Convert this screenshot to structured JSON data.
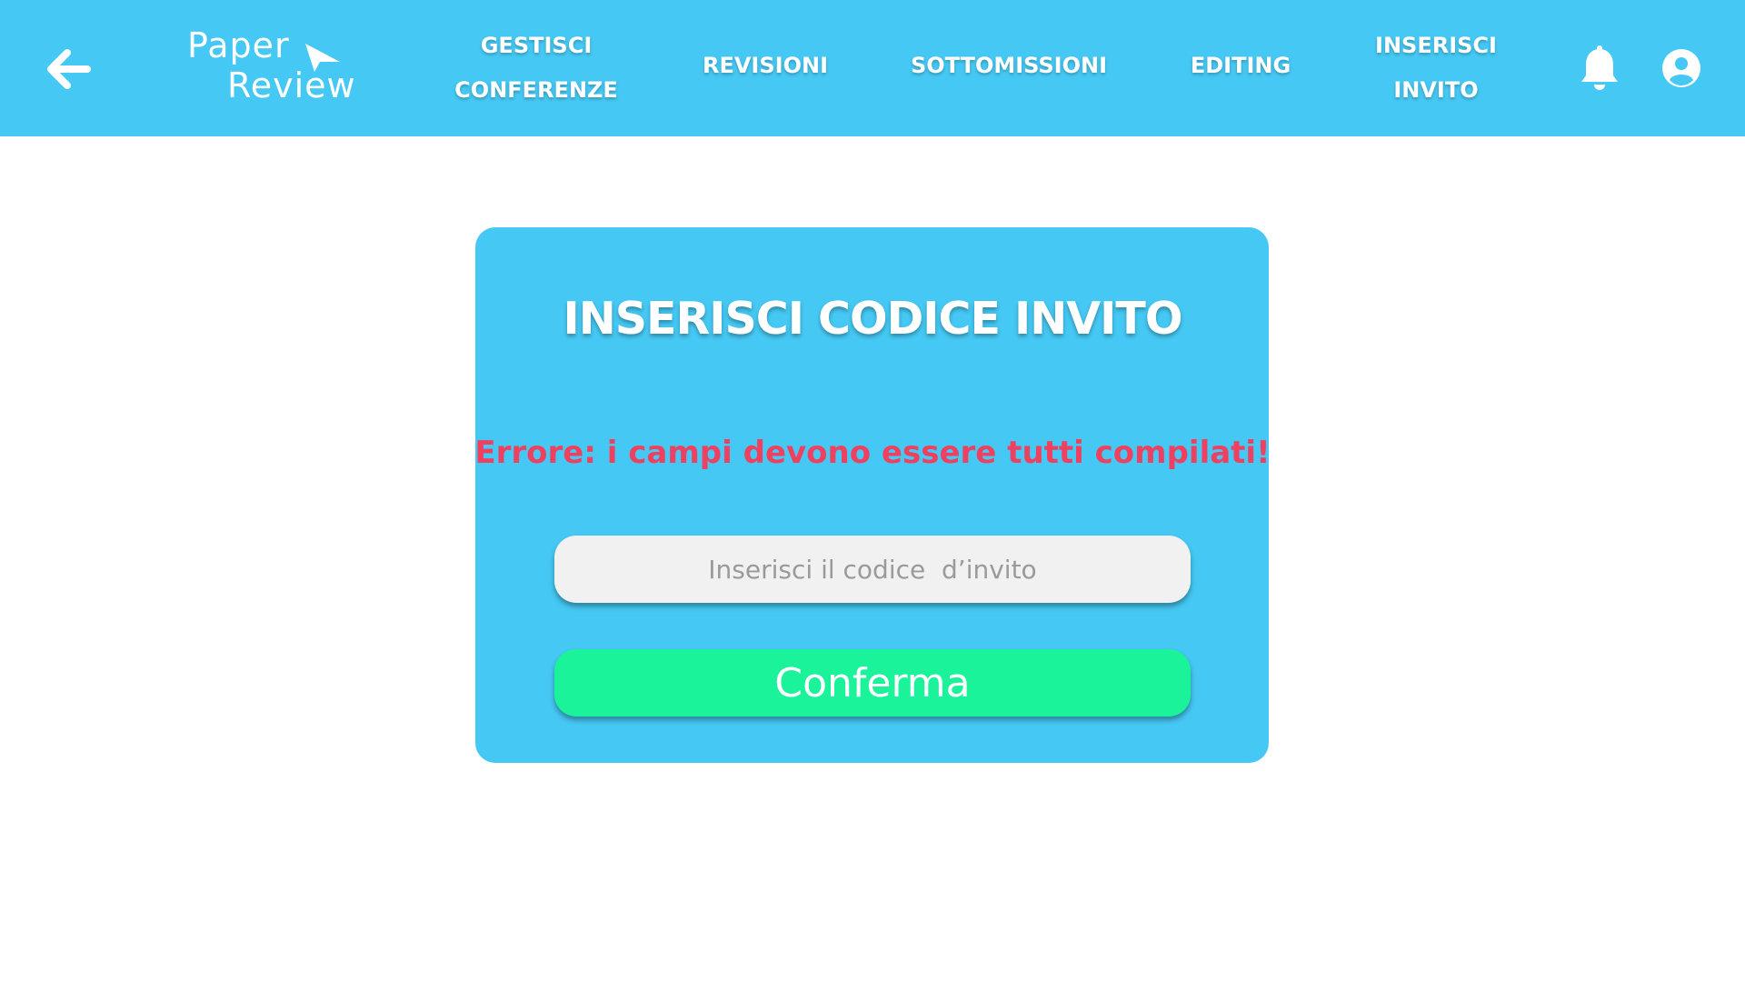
{
  "header": {
    "back_icon": "arrow-left-icon",
    "logo": {
      "line1": "Paper",
      "line2": "Review",
      "icon": "paper-plane-icon"
    },
    "nav": [
      {
        "line1": "GESTISCI",
        "line2": "CONFERENZE"
      },
      {
        "line1": "REVISIONI"
      },
      {
        "line1": "SOTTOMISSIONI"
      },
      {
        "line1": "EDITING"
      },
      {
        "line1": "INSERISCI",
        "line2": "INVITO"
      }
    ],
    "notification_icon": "bell-icon",
    "profile_icon": "user-circle-icon"
  },
  "form": {
    "title": "INSERISCI CODICE INVITO",
    "error": "Errore: i campi devono essere tutti compilati!",
    "code_input": {
      "value": "",
      "placeholder": "Inserisci il codice  d’invito"
    },
    "confirm_label": "Conferma"
  },
  "colors": {
    "primary": "#45c8f3",
    "confirm": "#1bf39b",
    "error": "#f0405f",
    "input_bg": "#f1f1f1"
  }
}
